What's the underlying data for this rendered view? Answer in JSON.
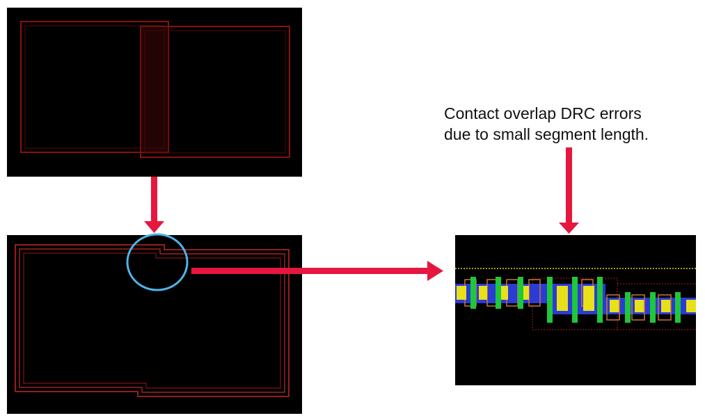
{
  "annotation": {
    "lines": [
      "Contact overlap  DRC errors",
      "due to small segment length."
    ]
  },
  "colors": {
    "background": "#ffffff",
    "panel": "#000000",
    "red_outline": "#7a0c0c",
    "bright_red_outline": "#c62828",
    "arrow": "#e5173f",
    "highlight_circle": "#4fb3e8",
    "metal_blue": "#2a3bd6",
    "contact_yellow": "#e8e01a",
    "via_green": "#1fc73a",
    "via_orange": "#c8773a",
    "guide_yellow": "#e0d820"
  },
  "panels": [
    {
      "id": "overlapping-rectangles",
      "description_icon": "layout-panel"
    },
    {
      "id": "merged-outline",
      "description_icon": "layout-panel"
    },
    {
      "id": "zoomed-contacts",
      "description_icon": "layout-panel"
    }
  ]
}
